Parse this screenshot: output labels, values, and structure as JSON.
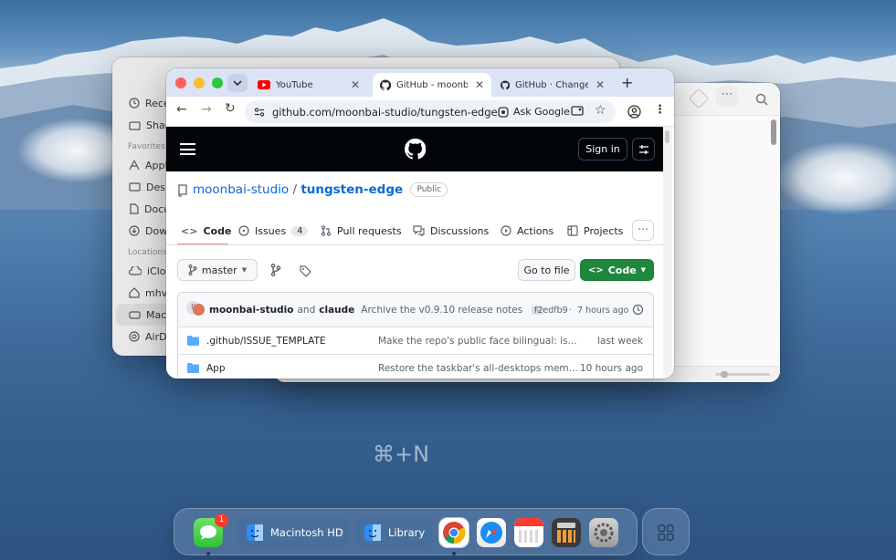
{
  "finder": {
    "items_top": [
      "Recents",
      "Shared"
    ],
    "favorites_header": "Favorites",
    "favorites": [
      "Applications",
      "Desktop",
      "Documents",
      "Downloads"
    ],
    "locations_header": "Locations",
    "locations": [
      "iCloud",
      "mhv",
      "Macintosh HD",
      "AirDrop"
    ]
  },
  "browser": {
    "tabs": [
      {
        "title": "YouTube",
        "icon": "youtube-icon"
      },
      {
        "title": "GitHub - moonbai-studio/tungsten-edge",
        "icon": "github-icon"
      },
      {
        "title": "GitHub · Change is constant",
        "icon": "github-icon"
      }
    ],
    "url": "github.com/moonbai-studio/tungsten-edge",
    "ask_google": "Ask Google"
  },
  "github": {
    "sign_in": "Sign in",
    "owner": "moonbai-studio",
    "separator": "/",
    "repo": "tungsten-edge",
    "visibility": "Public",
    "nav": [
      {
        "label": "Code",
        "icon": "code-icon"
      },
      {
        "label": "Issues",
        "icon": "issues-icon",
        "count": "4"
      },
      {
        "label": "Pull requests",
        "icon": "pull-request-icon"
      },
      {
        "label": "Discussions",
        "icon": "discussions-icon"
      },
      {
        "label": "Actions",
        "icon": "actions-icon"
      },
      {
        "label": "Projects",
        "icon": "projects-icon"
      }
    ],
    "branch": "master",
    "go_to_file": "Go to file",
    "code_button": "Code",
    "commit": {
      "authors": "moonbai-studio",
      "and": "and",
      "coauthor": "claude",
      "message": "Archive the v0.9.10 release notes",
      "hash": "f2edfb9",
      "sep": "·",
      "time": "7 hours ago"
    },
    "files": [
      {
        "name": ".github/ISSUE_TEMPLATE",
        "message": "Make the repo's public face bilingual: is...",
        "time": "last week"
      },
      {
        "name": "App",
        "message": "Restore the taskbar's all-desktops mem...",
        "time": "10 hours ago"
      }
    ]
  },
  "shortcut": "⌘+N",
  "dock": {
    "messages_badge": "1",
    "pill1": "Macintosh HD",
    "pill2": "Library"
  },
  "colors": {
    "github_green": "#1f883d",
    "github_link": "#0969da",
    "tabbar": "#dbe3f5"
  }
}
